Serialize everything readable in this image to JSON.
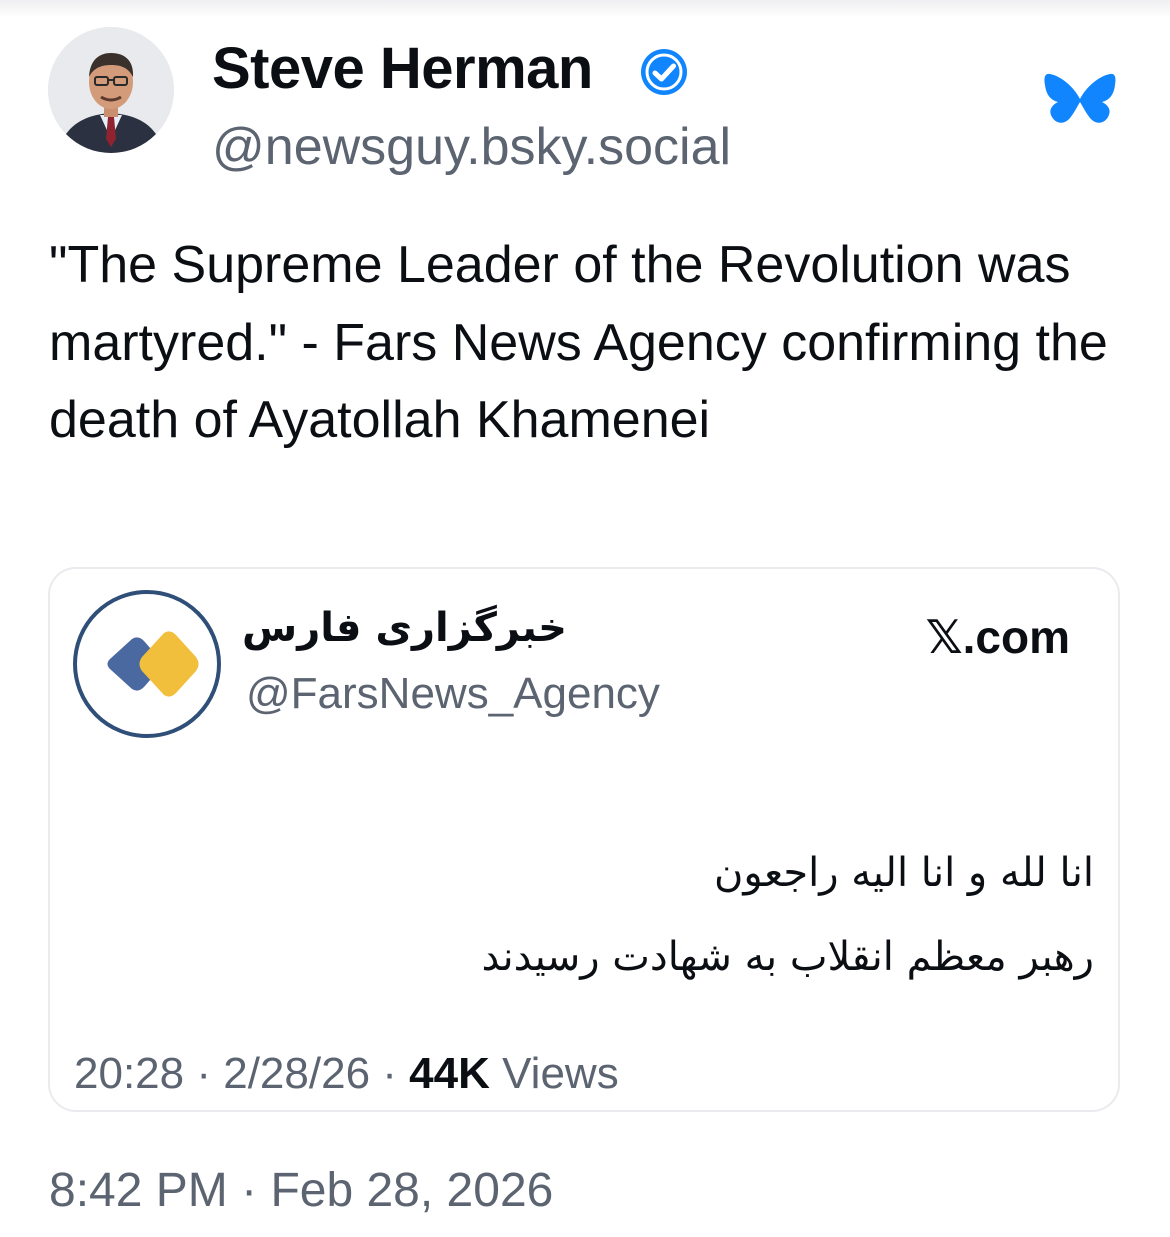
{
  "post": {
    "author_name": "Steve Herman",
    "author_handle": "@newsguy.bsky.social",
    "verified_icon": "verified-badge-icon",
    "platform_icon": "bluesky-butterfly-icon",
    "text": "\"The Supreme Leader of the Revolution was martyred.\" - Fars News Agency confirming the death of Ayatollah Khamenei",
    "timestamp": "8:42 PM",
    "date": "Feb 28, 2026",
    "meta_separator": "·"
  },
  "embed": {
    "account_name": "خبرگزاری فارس",
    "account_handle": "@FarsNews_Agency",
    "logo_icon": "fars-news-logo-icon",
    "source_label": "𝕏.com",
    "body_lines": [
      "انا لله و انا الیه راجعون",
      "رهبر معظم انقلاب به شهادت رسیدند"
    ],
    "time": "20:28",
    "date": "2/28/26",
    "views_count": "44K",
    "views_label": "Views",
    "separator": "·"
  },
  "colors": {
    "text_primary": "#0b0f14",
    "text_secondary": "#5b6470",
    "verified_blue": "#1185fe",
    "bluesky_blue": "#1185fe",
    "fars_ring": "#2f4e78",
    "fars_blue": "#4a69a0",
    "fars_yellow": "#f2bf3c",
    "card_border": "#e9ebee"
  }
}
